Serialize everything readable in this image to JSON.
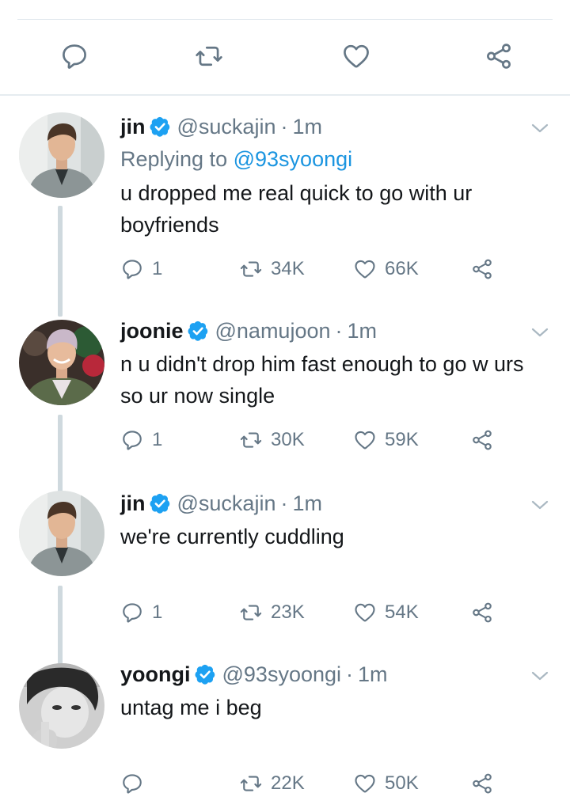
{
  "colors": {
    "icon_gray": "#657786",
    "verified_blue": "#1da1f2",
    "link_blue": "#1b95e0",
    "thread_line": "#cfd9de"
  },
  "top_actions": {
    "icons": [
      "reply-icon",
      "retweet-icon",
      "like-icon",
      "share-icon"
    ]
  },
  "tweets": [
    {
      "name": "jin",
      "handle": "@suckajin",
      "sep": "·",
      "time": "1m",
      "replying_prefix": "Replying to",
      "replying_handle": "@93syoongi",
      "text": "u dropped me real quick to go with ur boyfriends",
      "replies": "1",
      "retweets": "34K",
      "likes": "66K"
    },
    {
      "name": "joonie",
      "handle": "@namujoon",
      "sep": "·",
      "time": "1m",
      "text": "n u didn't drop him fast enough to go w urs so ur now single",
      "replies": "1",
      "retweets": "30K",
      "likes": "59K"
    },
    {
      "name": "jin",
      "handle": "@suckajin",
      "sep": "·",
      "time": "1m",
      "text": "we're currently cuddling",
      "replies": "1",
      "retweets": "23K",
      "likes": "54K"
    },
    {
      "name": "yoongi",
      "handle": "@93syoongi",
      "sep": "·",
      "time": "1m",
      "text": "untag me i beg",
      "replies": "",
      "retweets": "22K",
      "likes": "50K"
    }
  ]
}
